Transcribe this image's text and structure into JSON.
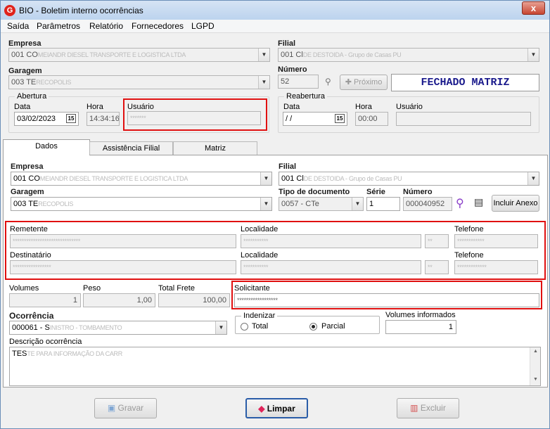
{
  "window": {
    "title": "BIO - Boletim interno ocorrências",
    "close_glyph": "x"
  },
  "menu": [
    "Saída",
    "Parâmetros",
    "Relatório",
    "Fornecedores",
    "LGPD"
  ],
  "header": {
    "empresa_label": "Empresa",
    "empresa_value": "001 CO",
    "empresa_hidden": "MEIANDR DIESEL TRANSPORTE E LOGISTICA LTDA",
    "filial_label": "Filial",
    "filial_value": "001 Cl",
    "filial_hidden": "DE DESTOIDA - Grupo de Casas PU",
    "garagem_label": "Garagem",
    "garagem_value": "003 TE",
    "garagem_hidden": "RECOPOLIS",
    "numero_label": "Número",
    "numero_value": "52",
    "proximo_label": "Próximo",
    "status_text": "FECHADO MATRIZ"
  },
  "abertura": {
    "title": "Abertura",
    "data_label": "Data",
    "data_value": "03/02/2023",
    "hora_label": "Hora",
    "hora_value": "14:34:16",
    "usuario_label": "Usuário",
    "usuario_value": "*******"
  },
  "reabertura": {
    "title": "Reabertura",
    "data_label": "Data",
    "data_value": " /  /",
    "hora_label": "Hora",
    "hora_value": "00:00",
    "usuario_label": "Usuário"
  },
  "tabs": [
    "Dados",
    "Assistência Filial",
    "Matriz"
  ],
  "dados": {
    "empresa_label": "Empresa",
    "empresa_value": "001 CO",
    "empresa_hidden": "MEIANDR DIESEL TRANSPORTE E LOGISTICA LTDA",
    "filial_label": "Filial",
    "filial_value": "001 Cl",
    "filial_hidden": "DE DESTOIDA - Grupo de Casas PU",
    "garagem_label": "Garagem",
    "garagem_value": "003 TE",
    "garagem_hidden": "RECOPOLIS",
    "tipo_doc_label": "Tipo de documento",
    "tipo_doc_value": "0057 - CTe",
    "serie_label": "Série",
    "serie_value": "1",
    "numero_label": "Número",
    "numero_value": "000040952",
    "incluir_anexo_label": "Incluir Anexo",
    "remetente_label": "Remetente",
    "remetente_value": "******************************",
    "loc1_label": "Localidade",
    "loc1_value": "***********",
    "uf1_value": "**",
    "tel1_label": "Telefone",
    "tel1_value": "************",
    "destinatario_label": "Destinatário",
    "destinatario_value": "*****************",
    "loc2_label": "Localidade",
    "loc2_value": "***********",
    "uf2_value": "**",
    "tel2_label": "Telefone",
    "tel2_value": "*************",
    "volumes_label": "Volumes",
    "volumes_value": "1",
    "peso_label": "Peso",
    "peso_value": "1,00",
    "frete_label": "Total Frete",
    "frete_value": "100,00",
    "solicitante_label": "Solicitante",
    "solicitante_value": "******************",
    "ocorrencia_label": "Ocorrência",
    "ocorrencia_value": "000061 - S",
    "ocorrencia_hidden": "INISTRO - TOMBAMENTO",
    "indenizar_title": "Indenizar",
    "total_label": "Total",
    "parcial_label": "Parcial",
    "volumes_inf_label": "Volumes informados",
    "volumes_inf_value": "1",
    "descricao_label": "Descrição ocorrência",
    "descricao_value": "TES",
    "descricao_hidden": "TE PARA INFORMAÇÃO DA CARR"
  },
  "buttons": {
    "gravar": "Gravar",
    "limpar": "Limpar",
    "excluir": "Excluir"
  },
  "colors": {
    "status_text": "#1a1a8c",
    "highlight": "#e01010"
  }
}
